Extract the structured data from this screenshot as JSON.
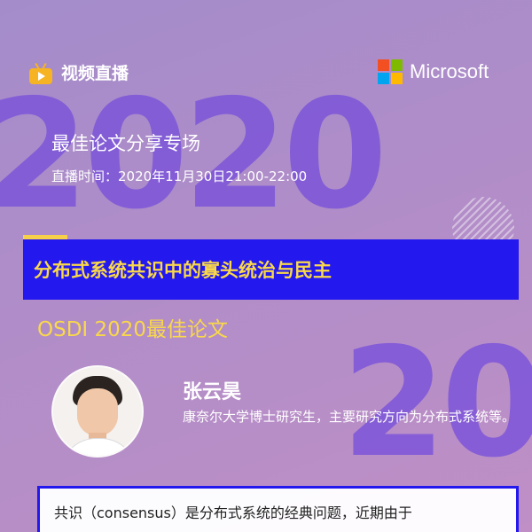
{
  "background": {
    "big_number_top": "2020",
    "big_number_bottom": "20"
  },
  "header": {
    "live_label": "视频直播",
    "live_icon": "tv-play-icon",
    "brand_name": "Microsoft",
    "brand_icon": "microsoft-logo-icon",
    "brand_colors": [
      "#f25022",
      "#7fba00",
      "#00a4ef",
      "#ffb900"
    ]
  },
  "event": {
    "title": "最佳论文分享专场",
    "time": "直播时间：2020年11月30日21:00-22:00"
  },
  "paper": {
    "title": "分布式系统共识中的寡头统治与民主",
    "award": "OSDI 2020最佳论文"
  },
  "speaker": {
    "name": "张云昊",
    "bio": "康奈尔大学博士研究生，主要研究方向为分布式系统等。"
  },
  "abstract": {
    "text": "共识（consensus）是分布式系统的经典问题，近期由于"
  },
  "colors": {
    "accent_blue": "#2318ee",
    "accent_yellow": "#f9d84a",
    "bg_purple": "#a48ccb",
    "number_purple": "#7d55d9"
  }
}
